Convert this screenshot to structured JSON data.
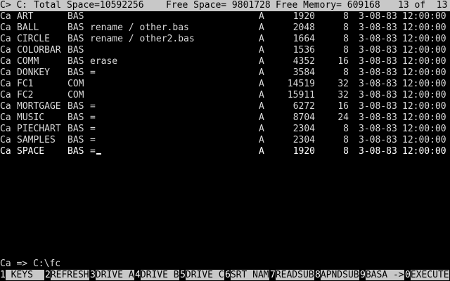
{
  "header": {
    "prompt": "C> C:",
    "total_space": "Total Space=10592256",
    "free_space": "Free Space= 9801728",
    "free_memory": "Free Memory= 609168",
    "position": "13 of  13"
  },
  "files": [
    {
      "tag": "Ca",
      "name": "ART",
      "ext": "BAS",
      "cmd": "",
      "attr": "A",
      "size": "1920",
      "sec": "8",
      "date": "3-08-83",
      "time": "12:00:00"
    },
    {
      "tag": "Ca",
      "name": "BALL",
      "ext": "BAS",
      "cmd": "rename / other.bas",
      "attr": "A",
      "size": "2048",
      "sec": "8",
      "date": "3-08-83",
      "time": "12:00:00"
    },
    {
      "tag": "Ca",
      "name": "CIRCLE",
      "ext": "BAS",
      "cmd": "rename / other2.bas",
      "attr": "A",
      "size": "1664",
      "sec": "8",
      "date": "3-08-83",
      "time": "12:00:00"
    },
    {
      "tag": "Ca",
      "name": "COLORBAR",
      "ext": "BAS",
      "cmd": "",
      "attr": "A",
      "size": "1536",
      "sec": "8",
      "date": "3-08-83",
      "time": "12:00:00"
    },
    {
      "tag": "Ca",
      "name": "COMM",
      "ext": "BAS",
      "cmd": "erase",
      "attr": "A",
      "size": "4352",
      "sec": "16",
      "date": "3-08-83",
      "time": "12:00:00"
    },
    {
      "tag": "Ca",
      "name": "DONKEY",
      "ext": "BAS",
      "cmd": "=",
      "attr": "A",
      "size": "3584",
      "sec": "8",
      "date": "3-08-83",
      "time": "12:00:00"
    },
    {
      "tag": "Ca",
      "name": "FC1",
      "ext": "COM",
      "cmd": "",
      "attr": "A",
      "size": "14519",
      "sec": "32",
      "date": "3-08-83",
      "time": "12:00:00"
    },
    {
      "tag": "Ca",
      "name": "FC2",
      "ext": "COM",
      "cmd": "",
      "attr": "A",
      "size": "15911",
      "sec": "32",
      "date": "3-08-83",
      "time": "12:00:00"
    },
    {
      "tag": "Ca",
      "name": "MORTGAGE",
      "ext": "BAS",
      "cmd": "=",
      "attr": "A",
      "size": "6272",
      "sec": "16",
      "date": "3-08-83",
      "time": "12:00:00"
    },
    {
      "tag": "Ca",
      "name": "MUSIC",
      "ext": "BAS",
      "cmd": "=",
      "attr": "A",
      "size": "8704",
      "sec": "24",
      "date": "3-08-83",
      "time": "12:00:00"
    },
    {
      "tag": "Ca",
      "name": "PIECHART",
      "ext": "BAS",
      "cmd": "=",
      "attr": "A",
      "size": "2304",
      "sec": "8",
      "date": "3-08-83",
      "time": "12:00:00"
    },
    {
      "tag": "Ca",
      "name": "SAMPLES",
      "ext": "BAS",
      "cmd": "=",
      "attr": "A",
      "size": "2304",
      "sec": "8",
      "date": "3-08-83",
      "time": "12:00:00"
    },
    {
      "tag": "Ca",
      "name": "SPACE",
      "ext": "BAS",
      "cmd": "=",
      "attr": "A",
      "size": "1920",
      "sec": "8",
      "date": "3-08-83",
      "time": "12:00:00"
    }
  ],
  "command_line": "Ca => C:\\fc",
  "function_keys": [
    {
      "num": "1",
      "label": " KEYS  "
    },
    {
      "num": "2",
      "label": "REFRESH"
    },
    {
      "num": "3",
      "label": "DRIVE A"
    },
    {
      "num": "4",
      "label": "DRIVE B"
    },
    {
      "num": "5",
      "label": "DRIVE C"
    },
    {
      "num": "6",
      "label": "SRT NAM"
    },
    {
      "num": "7",
      "label": "READSUB"
    },
    {
      "num": "8",
      "label": "APNDSUB"
    },
    {
      "num": "9",
      "label": "BASA ->"
    },
    {
      "num": "0",
      "label": "EXECUTE"
    }
  ],
  "colors": {
    "screen_bg": "#000000",
    "inverse_bg": "#c8c8c8",
    "text": "#d8d8d8"
  }
}
